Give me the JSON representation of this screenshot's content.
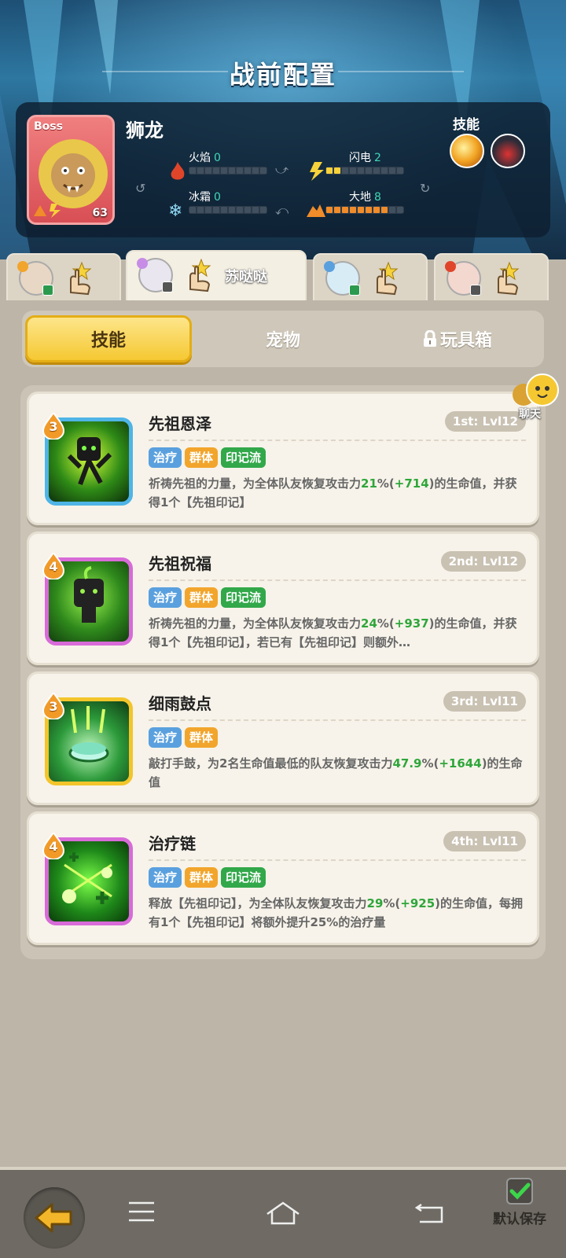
{
  "header": {
    "title": "战前配置"
  },
  "boss": {
    "tag": "Boss",
    "name": "狮龙",
    "level": "63",
    "stats": {
      "fire": {
        "label": "火焰",
        "value": "0",
        "level": 0
      },
      "lightning": {
        "label": "闪电",
        "value": "2",
        "level": 2
      },
      "frost": {
        "label": "冰霜",
        "value": "0",
        "level": 0
      },
      "earth": {
        "label": "大地",
        "value": "8",
        "level": 8
      }
    },
    "skills_label": "技能",
    "skill_icons": [
      "fire-orb-icon",
      "dragon-skill-icon"
    ]
  },
  "hero_tabs": [
    {
      "name": "",
      "active": false
    },
    {
      "name": "苏哒哒",
      "active": true
    },
    {
      "name": "",
      "active": false
    },
    {
      "name": "",
      "active": false
    }
  ],
  "category_tabs": {
    "skills": "技能",
    "pets": "宠物",
    "toybox": "玩具箱"
  },
  "chat": {
    "label": "聊天"
  },
  "skills": [
    {
      "title": "先祖恩泽",
      "rank": "1st: Lvl12",
      "cost": "3",
      "tags": [
        "治疗",
        "群体",
        "印记流"
      ],
      "desc_a": "祈祷先祖的力量，为全体队友恢复攻击力",
      "desc_pct": "21",
      "desc_pct_unit": "%(",
      "desc_bonus": "+714",
      "desc_b": ")的生命值，并获得1个【先祖印记】",
      "frame_color": "#4fb4e6"
    },
    {
      "title": "先祖祝福",
      "rank": "2nd: Lvl12",
      "cost": "4",
      "tags": [
        "治疗",
        "群体",
        "印记流"
      ],
      "desc_a": "祈祷先祖的力量，为全体队友恢复攻击力",
      "desc_pct": "24",
      "desc_pct_unit": "%(",
      "desc_bonus": "+937",
      "desc_b": ")的生命值，并获得1个【先祖印记】，若已有【先祖印记】则额外…",
      "frame_color": "#d86bd8"
    },
    {
      "title": "细雨鼓点",
      "rank": "3rd: Lvl11",
      "cost": "3",
      "tags": [
        "治疗",
        "群体"
      ],
      "desc_a": "敲打手鼓，为2名生命值最低的队友恢复攻击力",
      "desc_pct": "47.9",
      "desc_pct_unit": "%(",
      "desc_bonus": "+1644",
      "desc_b": ")的生命值",
      "frame_color": "#f3c52b"
    },
    {
      "title": "治疗链",
      "rank": "4th: Lvl11",
      "cost": "4",
      "tags": [
        "治疗",
        "群体",
        "印记流"
      ],
      "desc_a": "释放【先祖印记】，为全体队友恢复攻击力",
      "desc_pct": "29",
      "desc_pct_unit": "%(",
      "desc_bonus": "+925",
      "desc_b": ")的生命值，每拥有1个【先祖印记】将额外提升25%的治疗量",
      "frame_color": "#d86bd8"
    }
  ],
  "bottom": {
    "save_label": "默认保存",
    "save_checked": true
  },
  "colors": {
    "accent_yellow": "#f5c832",
    "highlight_green": "#2fa63b",
    "tag_blue": "#5aa0de",
    "tag_orange": "#f2a52c",
    "tag_green": "#32a84a"
  }
}
